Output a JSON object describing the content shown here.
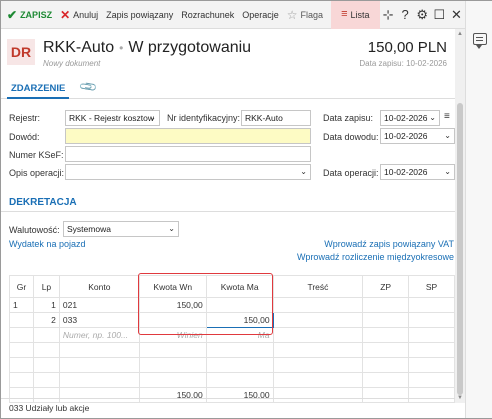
{
  "toolbar": {
    "save": "ZAPISZ",
    "cancel": "Anuluj",
    "related": "Zapis powiązany",
    "settlement": "Rozrachunek",
    "operations": "Operacje",
    "flag": "Flaga",
    "list": "Lista",
    "icons": [
      "pin-add-icon",
      "help-icon",
      "gear-icon",
      "maximize-icon",
      "close-icon"
    ],
    "colors": {
      "save": "#1e8a34",
      "cancel": "#d9262a",
      "list_bg": "#f8d7d7"
    }
  },
  "header": {
    "badge": "DR",
    "title": "RKK-Auto",
    "status": "W przygotowaniu",
    "subtitle": "Nowy dokument",
    "amount": "150,00 PLN",
    "record_date": "Data zapisu: 10-02-2026"
  },
  "tabs": [
    {
      "label": "ZDARZENIE"
    }
  ],
  "form": {
    "registry_label": "Rejestr:",
    "registry_value": "RKK - Rejestr kosztow",
    "id_label": "Nr identyfikacyjny:",
    "id_value": "RKK-Auto",
    "record_date_label": "Data zapisu:",
    "record_date_value": "10-02-2026",
    "proof_label": "Dowód:",
    "proof_value": "",
    "proof_date_label": "Data dowodu:",
    "proof_date_value": "10-02-2026",
    "ksef_label": "Numer KSeF:",
    "ksef_value": "",
    "op_desc_label": "Opis operacji:",
    "op_desc_value": "",
    "op_date_label": "Data operacji:",
    "op_date_value": "10-02-2026"
  },
  "dekretacja": {
    "title": "DEKRETACJA",
    "currency_label": "Walutowość:",
    "currency_value": "Systemowa",
    "link_car": "Wydatek na pojazd",
    "link_related": "Wprowadź zapis powiązany VAT",
    "link_interperiod": "Wprowadź rozliczenie międzyokresowe"
  },
  "grid": {
    "columns": [
      "Gr",
      "Lp",
      "Konto",
      "Kwota Wn",
      "Kwota Ma",
      "Treść",
      "ZP",
      "SP"
    ],
    "rows": [
      {
        "gr": "1",
        "lp": "1",
        "konto": "021",
        "wn": "150,00",
        "ma": ""
      },
      {
        "gr": "",
        "lp": "2",
        "konto": "033",
        "wn": "",
        "ma": "150,00"
      }
    ],
    "placeholders": {
      "konto": "Numer, np. 100...",
      "wn": "Winien",
      "ma": "Ma"
    },
    "totals": {
      "wn": "150,00",
      "ma": "150,00"
    },
    "highlight_color": "#e0393e"
  },
  "status_bar": "033   Udziały lub akcje"
}
